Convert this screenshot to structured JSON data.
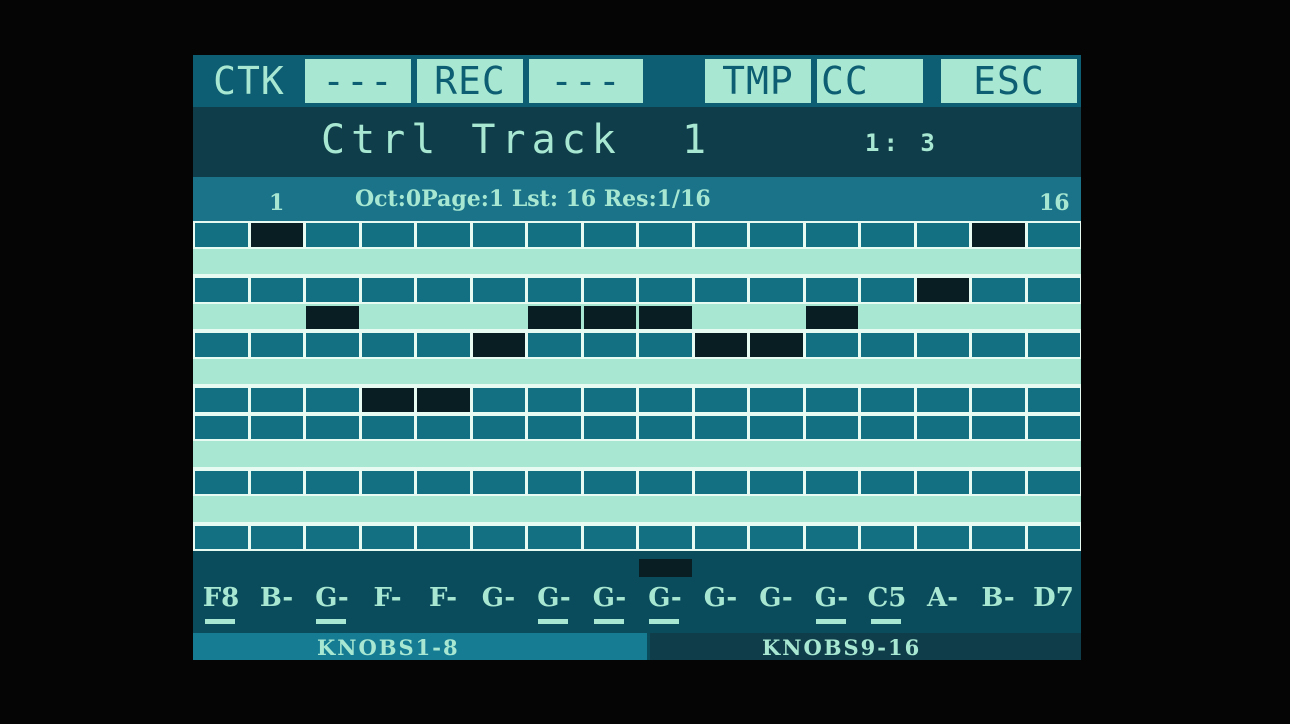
{
  "topbar": {
    "ctk": "CTK",
    "btn1": "---",
    "rec": "REC",
    "btn3": "---",
    "tmp": "TMP",
    "cc": "CC",
    "esc": "ESC"
  },
  "title": "Ctrl Track  1",
  "position": "1: 3",
  "info": {
    "first_step": "1",
    "status": "Oct:0Page:1 Lst: 16 Res:1/16",
    "last_step": "16"
  },
  "grid": {
    "rows": [
      {
        "shade": "dark",
        "active": [
          1,
          14
        ]
      },
      {
        "shade": "light",
        "active": []
      },
      {
        "shade": "dark",
        "active": [
          13
        ]
      },
      {
        "shade": "light",
        "active": [
          2,
          6,
          7,
          8,
          11
        ]
      },
      {
        "shade": "dark",
        "active": [
          5,
          9,
          10
        ]
      },
      {
        "shade": "light",
        "active": []
      },
      {
        "shade": "dark",
        "active": [
          3,
          4
        ]
      },
      {
        "shade": "dark",
        "active": []
      },
      {
        "shade": "light",
        "active": []
      },
      {
        "shade": "dark",
        "active": []
      },
      {
        "shade": "light",
        "active": []
      },
      {
        "shade": "dark",
        "active": []
      }
    ]
  },
  "playhead_step": 9,
  "notes": [
    "F8",
    "B-",
    "G-",
    "F-",
    "F-",
    "G-",
    "G-",
    "G-",
    "G-",
    "G-",
    "G-",
    "G-",
    "C5",
    "A-",
    "B-",
    "D7"
  ],
  "underlined_steps": [
    1,
    3,
    7,
    8,
    9,
    12,
    13
  ],
  "tabs": {
    "knobs_1_8": "KNOBS1-8",
    "knobs_9_16": "KNOBS9-16"
  },
  "colors": {
    "screen_bg": "#0a4b5c",
    "foreground": "#a8e8d2",
    "active_cell": "#081e23"
  }
}
